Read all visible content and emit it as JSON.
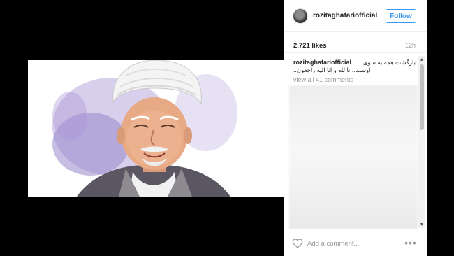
{
  "post": {
    "username": "rozitaghafariofficial",
    "follow_label": "Follow",
    "likes": "2,721 likes",
    "time": "12h",
    "caption_user": "rozitaghafariofficial",
    "caption_line1": "بازگشت همه به سوی",
    "caption_line2": "اوست..انا لله و انا الیه راجعون..",
    "view_all": "view all 41 comments",
    "comment_placeholder": "Add a comment...",
    "more_label": "•••"
  },
  "icons": {
    "avatar": "avatar",
    "heart": "heart-icon",
    "more": "more-options-icon",
    "scroll_up": "scroll-up-arrow",
    "scroll_down": "scroll-down-arrow"
  },
  "colors": {
    "accent": "#3897f0",
    "text": "#262626",
    "muted": "#999999",
    "background": "#000000"
  }
}
